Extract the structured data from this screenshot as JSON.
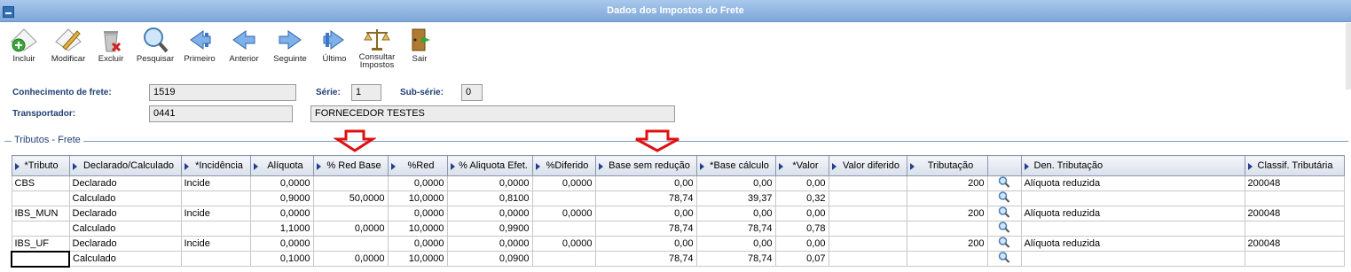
{
  "window": {
    "title": "Dados dos Impostos do Frete"
  },
  "toolbar": {
    "items": [
      {
        "label": "Incluir",
        "icon": "add-document-icon"
      },
      {
        "label": "Modificar",
        "icon": "edit-document-icon"
      },
      {
        "label": "Excluir",
        "icon": "trash-icon"
      },
      {
        "label": "Pesquisar",
        "icon": "magnifier-icon"
      },
      {
        "label": "Primeiro",
        "icon": "first-arrow-icon"
      },
      {
        "label": "Anterior",
        "icon": "previous-arrow-icon"
      },
      {
        "label": "Seguinte",
        "icon": "next-arrow-icon"
      },
      {
        "label": "Último",
        "icon": "last-arrow-icon"
      },
      {
        "label": "Consultar Impostos",
        "icon": "scales-icon"
      },
      {
        "label": "Sair",
        "icon": "exit-door-icon"
      }
    ]
  },
  "form": {
    "conhecimento_label": "Conhecimento de frete:",
    "conhecimento_value": "1519",
    "serie_label": "Série:",
    "serie_value": "1",
    "subserie_label": "Sub-série:",
    "subserie_value": "0",
    "transportador_label": "Transportador:",
    "transportador_code": "0441",
    "transportador_name": "FORNECEDOR TESTES"
  },
  "group": {
    "title": "Tributos - Frete"
  },
  "grid": {
    "columns": [
      "*Tributo",
      "Declarado/Calculado",
      "*Incidência",
      "Alíquota",
      "% Red Base",
      "%Red",
      "% Aliquota Efet.",
      "%Diferido",
      "Base sem redução",
      "*Base cálculo",
      "*Valor",
      "Valor diferido",
      "Tributação",
      "",
      "Den. Tributação",
      "Classif. Tributária"
    ],
    "rows": [
      [
        "CBS",
        "Declarado",
        "Incide",
        "0,0000",
        "",
        "0,0000",
        "0,0000",
        "0,0000",
        "0,00",
        "0,00",
        "0,00",
        "",
        "200",
        "",
        "Alíquota reduzida",
        "200048"
      ],
      [
        "",
        "Calculado",
        "",
        "0,9000",
        "50,0000",
        "10,0000",
        "0,8100",
        "",
        "78,74",
        "39,37",
        "0,32",
        "",
        "",
        "",
        "",
        ""
      ],
      [
        "IBS_MUN",
        "Declarado",
        "Incide",
        "0,0000",
        "",
        "0,0000",
        "0,0000",
        "0,0000",
        "0,00",
        "0,00",
        "0,00",
        "",
        "200",
        "",
        "Alíquota reduzida",
        "200048"
      ],
      [
        "",
        "Calculado",
        "",
        "1,1000",
        "0,0000",
        "10,0000",
        "0,9900",
        "",
        "78,74",
        "78,74",
        "0,78",
        "",
        "",
        "",
        "",
        ""
      ],
      [
        "IBS_UF",
        "Declarado",
        "Incide",
        "0,0000",
        "",
        "0,0000",
        "0,0000",
        "0,0000",
        "0,00",
        "0,00",
        "0,00",
        "",
        "200",
        "",
        "Alíquota reduzida",
        "200048"
      ],
      [
        "",
        "Calculado",
        "",
        "0,1000",
        "0,0000",
        "10,0000",
        "0,0900",
        "",
        "78,74",
        "78,74",
        "0,07",
        "",
        "",
        "",
        "",
        ""
      ]
    ]
  }
}
